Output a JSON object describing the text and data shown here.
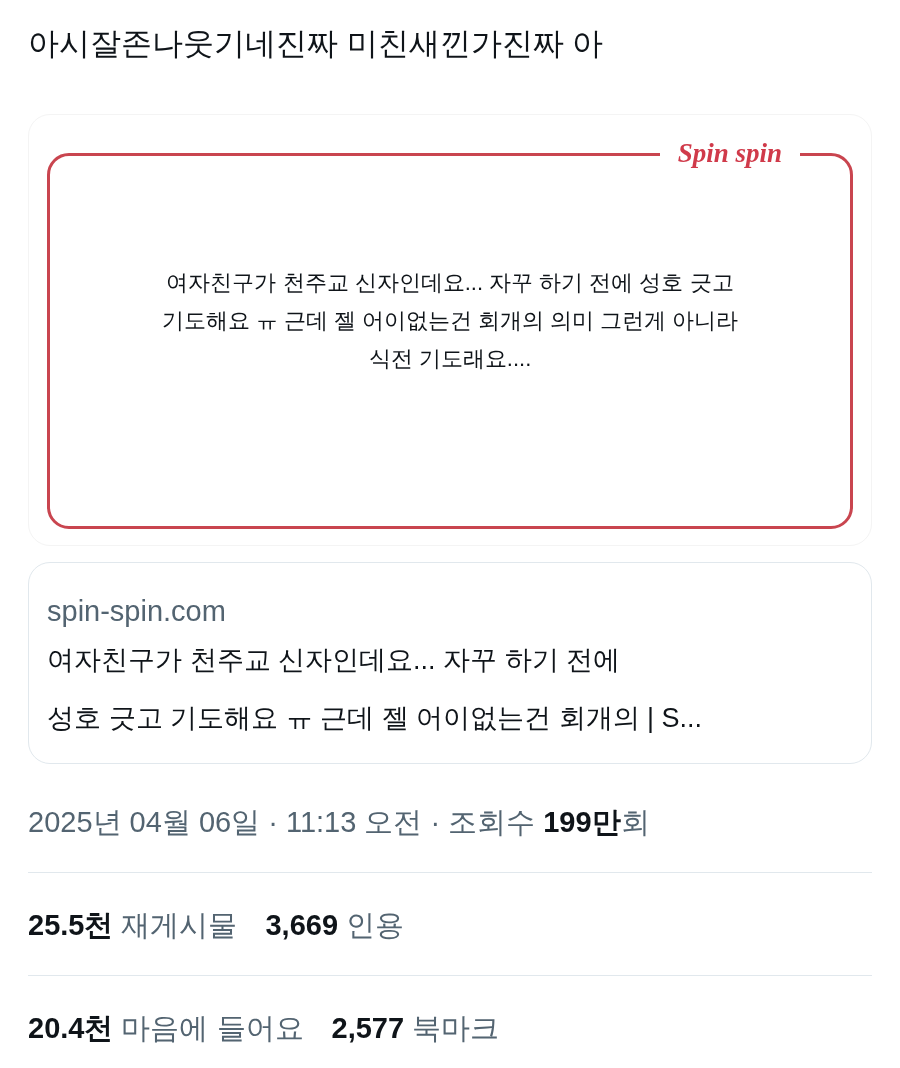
{
  "post_text": "아시잘존나웃기네진짜 미친새낀가진짜 아",
  "image_card": {
    "logo": "Spin spin",
    "lines": [
      "여자친구가 천주교 신자인데요... 자꾸 하기 전에 성호 긋고",
      "기도해요 ㅠ 근데 젤 어이없는건 회개의 의미 그런게 아니라",
      "식전 기도래요...."
    ]
  },
  "link_card": {
    "domain": "spin-spin.com",
    "title_lines": [
      "여자친구가 천주교 신자인데요... 자꾸 하기 전에",
      "성호 긋고 기도해요 ㅠ 근데 젤 어이없는건 회개의 | S..."
    ]
  },
  "meta": "2025년 04월 06일 · 11:13 오전 · 조회수 **199만**회",
  "stat_rows": [
    [
      {
        "count": "25.5천",
        "label": "재게시물"
      },
      {
        "count": "3,669",
        "label": "인용"
      }
    ],
    [
      {
        "count": "20.4천",
        "label": "마음에 들어요"
      },
      {
        "count": "2,577",
        "label": "북마크"
      }
    ]
  ]
}
